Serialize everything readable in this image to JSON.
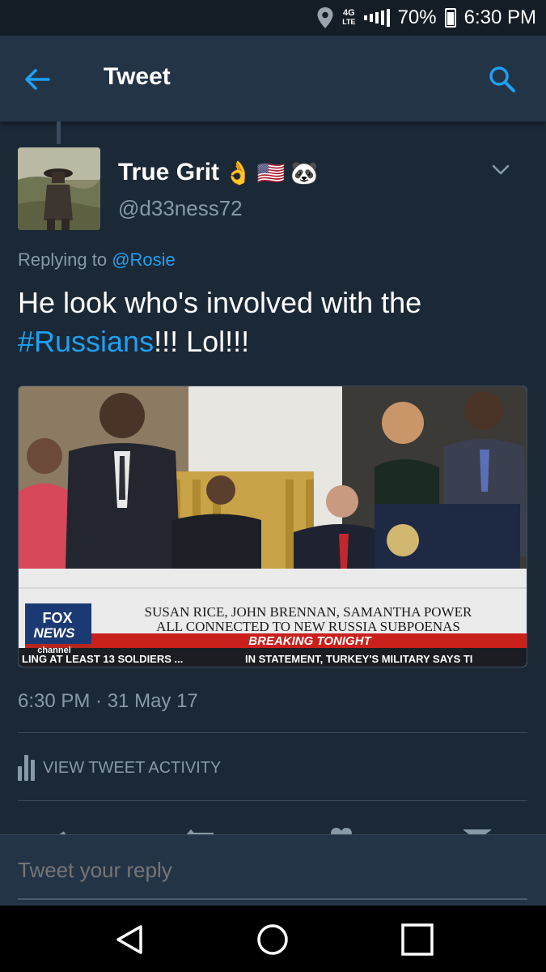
{
  "status_bar": {
    "network_top": "4G",
    "network_bottom": "LTE",
    "battery": "70%",
    "time": "6:30 PM",
    "icons": [
      "location-icon",
      "signal-icon",
      "battery-icon"
    ]
  },
  "header": {
    "title": "Tweet",
    "back_icon": "arrow-left-icon",
    "search_icon": "search-icon"
  },
  "tweet": {
    "display_name": "True Grit",
    "name_emojis": [
      "👌",
      "🇺🇸",
      "🐼"
    ],
    "handle": "@d33ness72",
    "replying_prefix": "Replying to",
    "replying_to": "@Rosie",
    "text_before": "He look who's involved with the",
    "hashtag": "#Russians",
    "text_after": "!!! Lol!!!",
    "media": {
      "logo_top": "FOX",
      "logo_mid": "NEWS",
      "logo_bottom": "channel",
      "headline_line1": "SUSAN RICE, JOHN BRENNAN, SAMANTHA POWER",
      "headline_line2": "ALL CONNECTED TO NEW RUSSIA SUBPOENAS",
      "banner": "BREAKING TONIGHT",
      "ticker_left": "LING AT LEAST 13 SOLDIERS ...",
      "ticker_right": "IN STATEMENT, TURKEY'S MILITARY SAYS TI"
    },
    "timestamp": "6:30 PM · 31 May 17",
    "activity_label": "VIEW TWEET ACTIVITY"
  },
  "reply": {
    "placeholder": "Tweet your reply"
  },
  "nav": {
    "icons": [
      "back-triangle-icon",
      "home-circle-icon",
      "recents-square-icon"
    ]
  },
  "colors": {
    "background": "#1b2836",
    "header": "#243447",
    "accent": "#1da1f2",
    "muted": "#8899a6"
  }
}
